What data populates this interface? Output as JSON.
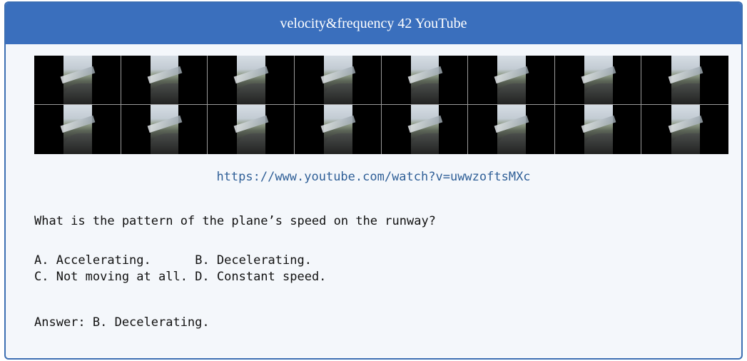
{
  "card": {
    "title": "velocity&frequency 42 YouTube",
    "url": "https://www.youtube.com/watch?v=uwwzoftsMXc",
    "question": "What is the pattern of the plane’s speed on the runway?",
    "options": [
      {
        "label": "A. Accelerating.",
        "pad": "     "
      },
      {
        "label": "B. Decelerating.",
        "pad": ""
      },
      {
        "label": "C. Not moving at all.",
        "pad": " "
      },
      {
        "label": "D. Constant speed.",
        "pad": ""
      }
    ],
    "answer": "Answer: B. Decelerating."
  },
  "colors": {
    "header_bg": "#3a6fbd",
    "card_bg": "#f4f7fb",
    "link": "#2f5f97"
  },
  "thumbnails": {
    "count": 16,
    "subject": "airplane-window-runway-frame"
  }
}
